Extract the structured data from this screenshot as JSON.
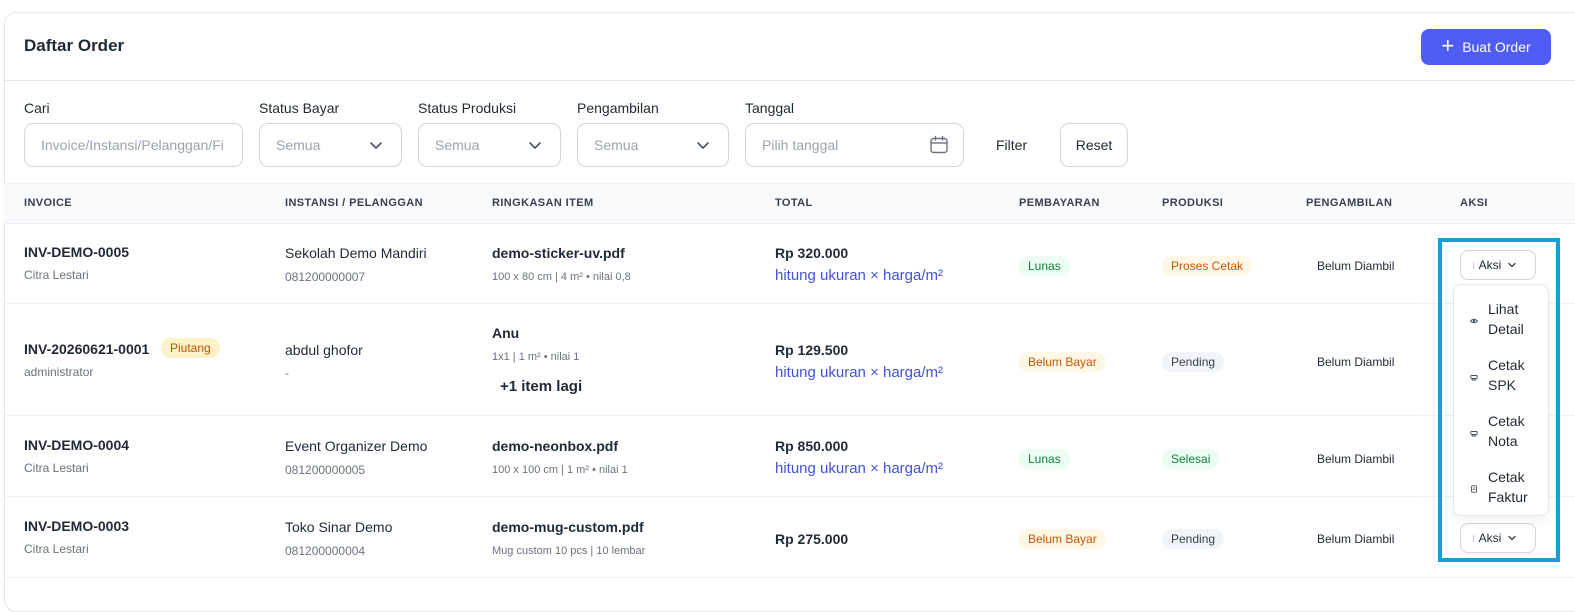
{
  "header": {
    "title": "Daftar Order",
    "new_button_label": "Buat Order"
  },
  "filters": {
    "search_label": "Cari",
    "search_placeholder": "Invoice/Instansi/Pelanggan/Fi",
    "status_bayar_label": "Status Bayar",
    "status_bayar_value": "Semua",
    "status_produksi_label": "Status Produksi",
    "status_produksi_value": "Semua",
    "pengambilan_label": "Pengambilan",
    "pengambilan_value": "Semua",
    "tanggal_label": "Tanggal",
    "tanggal_placeholder": "Pilih tanggal",
    "filter_label": "Filter",
    "reset_label": "Reset"
  },
  "table": {
    "headers": [
      "INVOICE",
      "INSTANSI / PELANGGAN",
      "RINGKASAN ITEM",
      "TOTAL",
      "PEMBAYARAN",
      "PRODUKSI",
      "PENGAMBILAN",
      "AKSI"
    ],
    "rows": [
      {
        "invoice": "INV-DEMO-0005",
        "created_by": "Citra Lestari",
        "customer": "Sekolah Demo Mandiri",
        "phone": "081200000007",
        "item": "demo-sticker-uv.pdf",
        "item_detail": "100 x 80 cm | 4 m² • nilai 0,8",
        "total": "Rp 320.000",
        "formula": "hitung ukuran × harga/m²",
        "payment": "Lunas",
        "production": "Proses Cetak",
        "pickup": "Belum Diambil",
        "action": "Aksi"
      },
      {
        "invoice": "INV-20260621-0001",
        "badge": "Piutang",
        "created_by": "administrator",
        "customer": "abdul ghofor",
        "phone": "-",
        "item": "Anu",
        "item_detail": "1x1 | 1 m² • nilai 1",
        "more_items": "+1 item lagi",
        "total": "Rp 129.500",
        "formula": "hitung ukuran × harga/m²",
        "payment": "Belum Bayar",
        "production": "Pending",
        "pickup": "Belum Diambil"
      },
      {
        "invoice": "INV-DEMO-0004",
        "created_by": "Citra Lestari",
        "customer": "Event Organizer Demo",
        "phone": "081200000005",
        "item": "demo-neonbox.pdf",
        "item_detail": "100 x 100 cm | 1 m² • nilai 1",
        "total": "Rp 850.000",
        "formula": "hitung ukuran × harga/m²",
        "payment": "Lunas",
        "production": "Selesai",
        "pickup": "Belum Diambil"
      },
      {
        "invoice": "INV-DEMO-0003",
        "created_by": "Citra Lestari",
        "customer": "Toko Sinar Demo",
        "phone": "081200000004",
        "item": "demo-mug-custom.pdf",
        "item_detail": "Mug custom 10 pcs | 10 lembar",
        "total": "Rp 275.000",
        "payment": "Belum Bayar",
        "production": "Pending",
        "pickup": "Belum Diambil",
        "action": "Aksi"
      }
    ]
  },
  "action_menu": {
    "items": [
      {
        "line1": "Lihat",
        "line2": "Detail",
        "icon": "eye-icon"
      },
      {
        "line1": "Cetak",
        "line2": "SPK",
        "icon": "printer-icon"
      },
      {
        "line1": "Cetak",
        "line2": "Nota",
        "icon": "printer-icon"
      },
      {
        "line1": "Cetak",
        "line2": "Faktur",
        "icon": "document-icon"
      }
    ]
  },
  "colors": {
    "primary": "#4f5df4",
    "formula_link": "#4353d6",
    "highlight": "#1a9ed8"
  }
}
